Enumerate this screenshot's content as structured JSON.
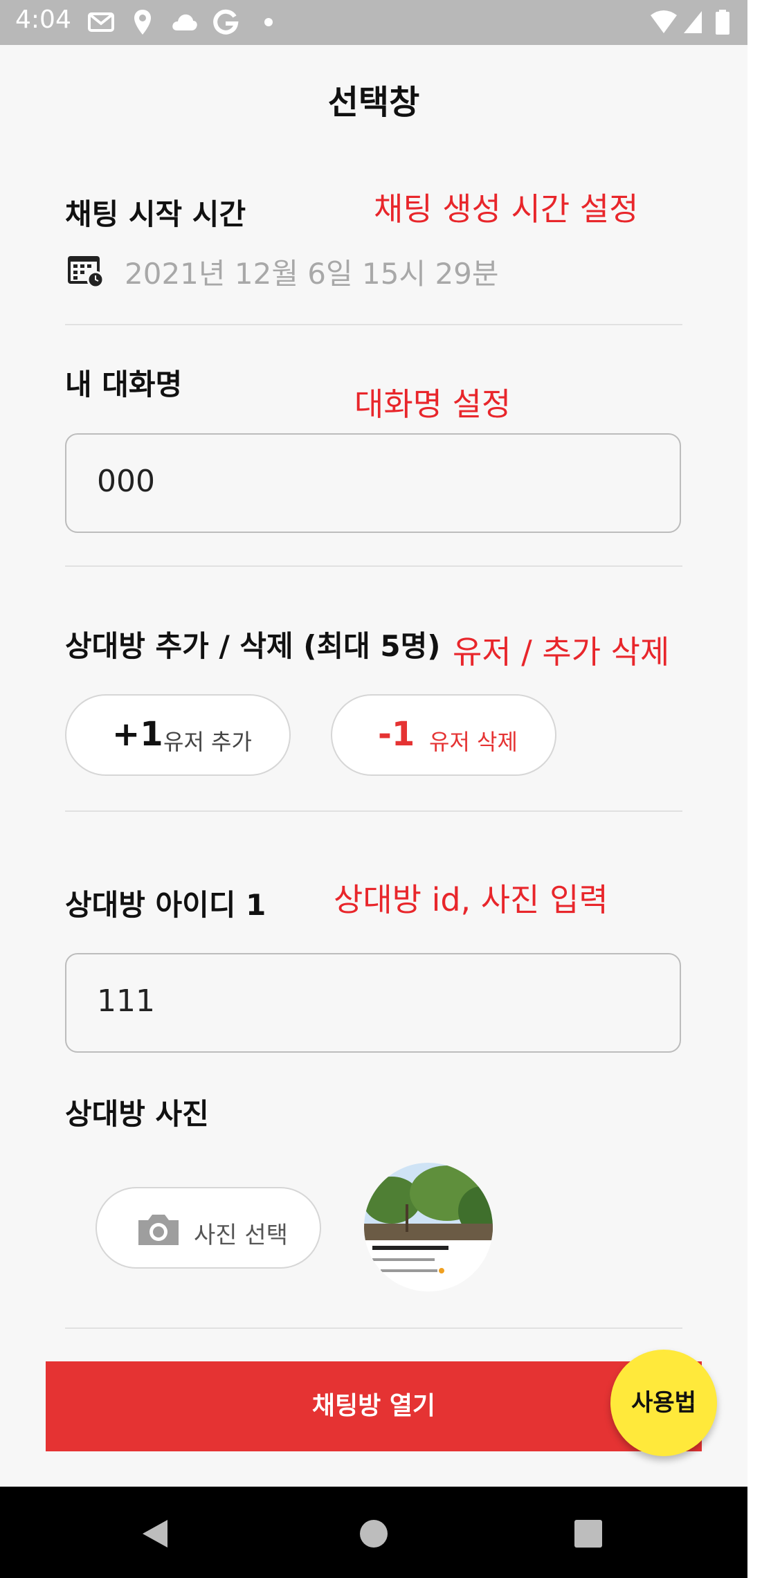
{
  "status_bar": {
    "time": "4:04",
    "icons": [
      "gmail-icon",
      "location-icon",
      "cloud-icon",
      "google-icon",
      "dot-icon",
      "wifi-icon",
      "signal-icon",
      "battery-icon"
    ]
  },
  "page": {
    "title": "선택창"
  },
  "chat_start": {
    "label": "채팅 시작 시간",
    "annotation": "채팅 생성 시간 설정",
    "datetime": "2021년 12월 6일  15시 29분"
  },
  "my_name": {
    "label": "내 대화명",
    "annotation": "대화명 설정",
    "value": "000"
  },
  "users": {
    "label": "상대방 추가 / 삭제 (최대 5명)",
    "annotation": "유저 / 추가 삭제",
    "add": {
      "big": "+1",
      "small": "유저 추가"
    },
    "remove": {
      "big": "-1",
      "small": "유저 삭제"
    }
  },
  "partner": {
    "id_label": "상대방 아이디 1",
    "annotation": "상대방 id, 사진 입력",
    "id_value": "111",
    "photo_label": "상대방 사진",
    "photo_button": "사진 선택"
  },
  "actions": {
    "open_chat": "채팅방 열기",
    "help_fab": "사용법"
  },
  "colors": {
    "accent_red": "#e53333",
    "annotation_red": "#e8262b",
    "fab_yellow": "#ffe93b"
  }
}
